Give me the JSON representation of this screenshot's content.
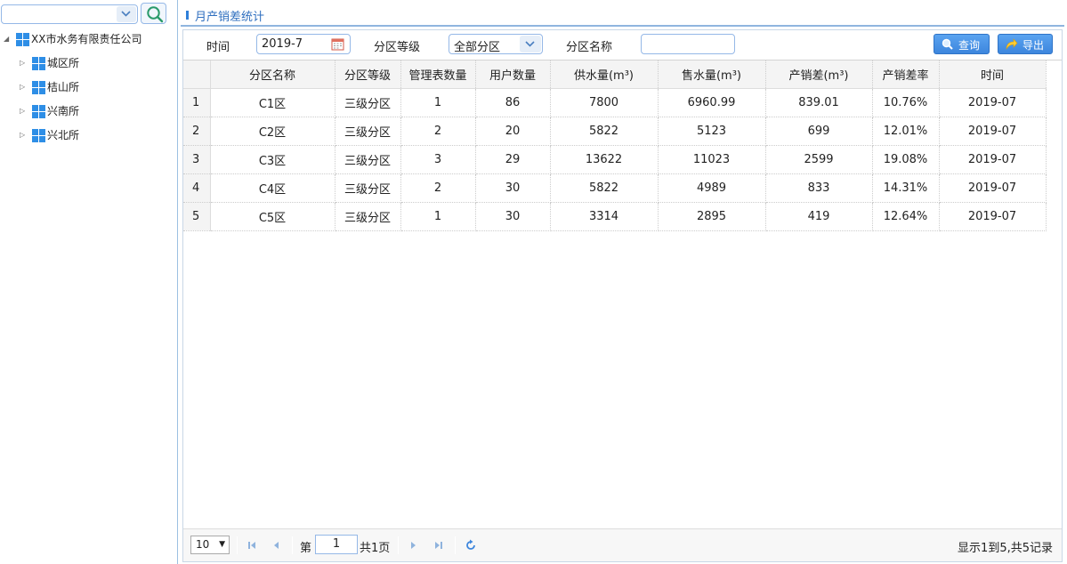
{
  "sidebar": {
    "search": {
      "value": ""
    },
    "tree": [
      {
        "label": "XX市水务有限责任公司",
        "level": 0,
        "expanded": true
      },
      {
        "label": "城区所",
        "level": 1,
        "expanded": false
      },
      {
        "label": "桔山所",
        "level": 1,
        "expanded": false
      },
      {
        "label": "兴南所",
        "level": 1,
        "expanded": false
      },
      {
        "label": "兴北所",
        "level": 1,
        "expanded": false
      }
    ]
  },
  "panel": {
    "title": "月产销差统计"
  },
  "filters": {
    "time_label": "时间",
    "time_value": "2019-7",
    "level_label": "分区等级",
    "level_value": "全部分区",
    "name_label": "分区名称",
    "name_value": "",
    "query_button": "查询",
    "export_button": "导出"
  },
  "table": {
    "columns": [
      "分区名称",
      "分区等级",
      "管理表数量",
      "用户数量",
      "供水量(m³)",
      "售水量(m³)",
      "产销差(m³)",
      "产销差率",
      "时间"
    ],
    "rows": [
      [
        "1",
        "C1区",
        "三级分区",
        "1",
        "86",
        "7800",
        "6960.99",
        "839.01",
        "10.76%",
        "2019-07"
      ],
      [
        "2",
        "C2区",
        "三级分区",
        "2",
        "20",
        "5822",
        "5123",
        "699",
        "12.01%",
        "2019-07"
      ],
      [
        "3",
        "C3区",
        "三级分区",
        "3",
        "29",
        "13622",
        "11023",
        "2599",
        "19.08%",
        "2019-07"
      ],
      [
        "4",
        "C4区",
        "三级分区",
        "2",
        "30",
        "5822",
        "4989",
        "833",
        "14.31%",
        "2019-07"
      ],
      [
        "5",
        "C5区",
        "三级分区",
        "1",
        "30",
        "3314",
        "2895",
        "419",
        "12.64%",
        "2019-07"
      ]
    ]
  },
  "pager": {
    "page_size": "10",
    "page_prefix": "第",
    "page_number": "1",
    "page_total": "共1页",
    "info": "显示1到5,共5记录"
  },
  "colors": {
    "accent": "#3d86dd",
    "tree_icon": "#2e8ee6",
    "title": "#2f6fbf"
  }
}
